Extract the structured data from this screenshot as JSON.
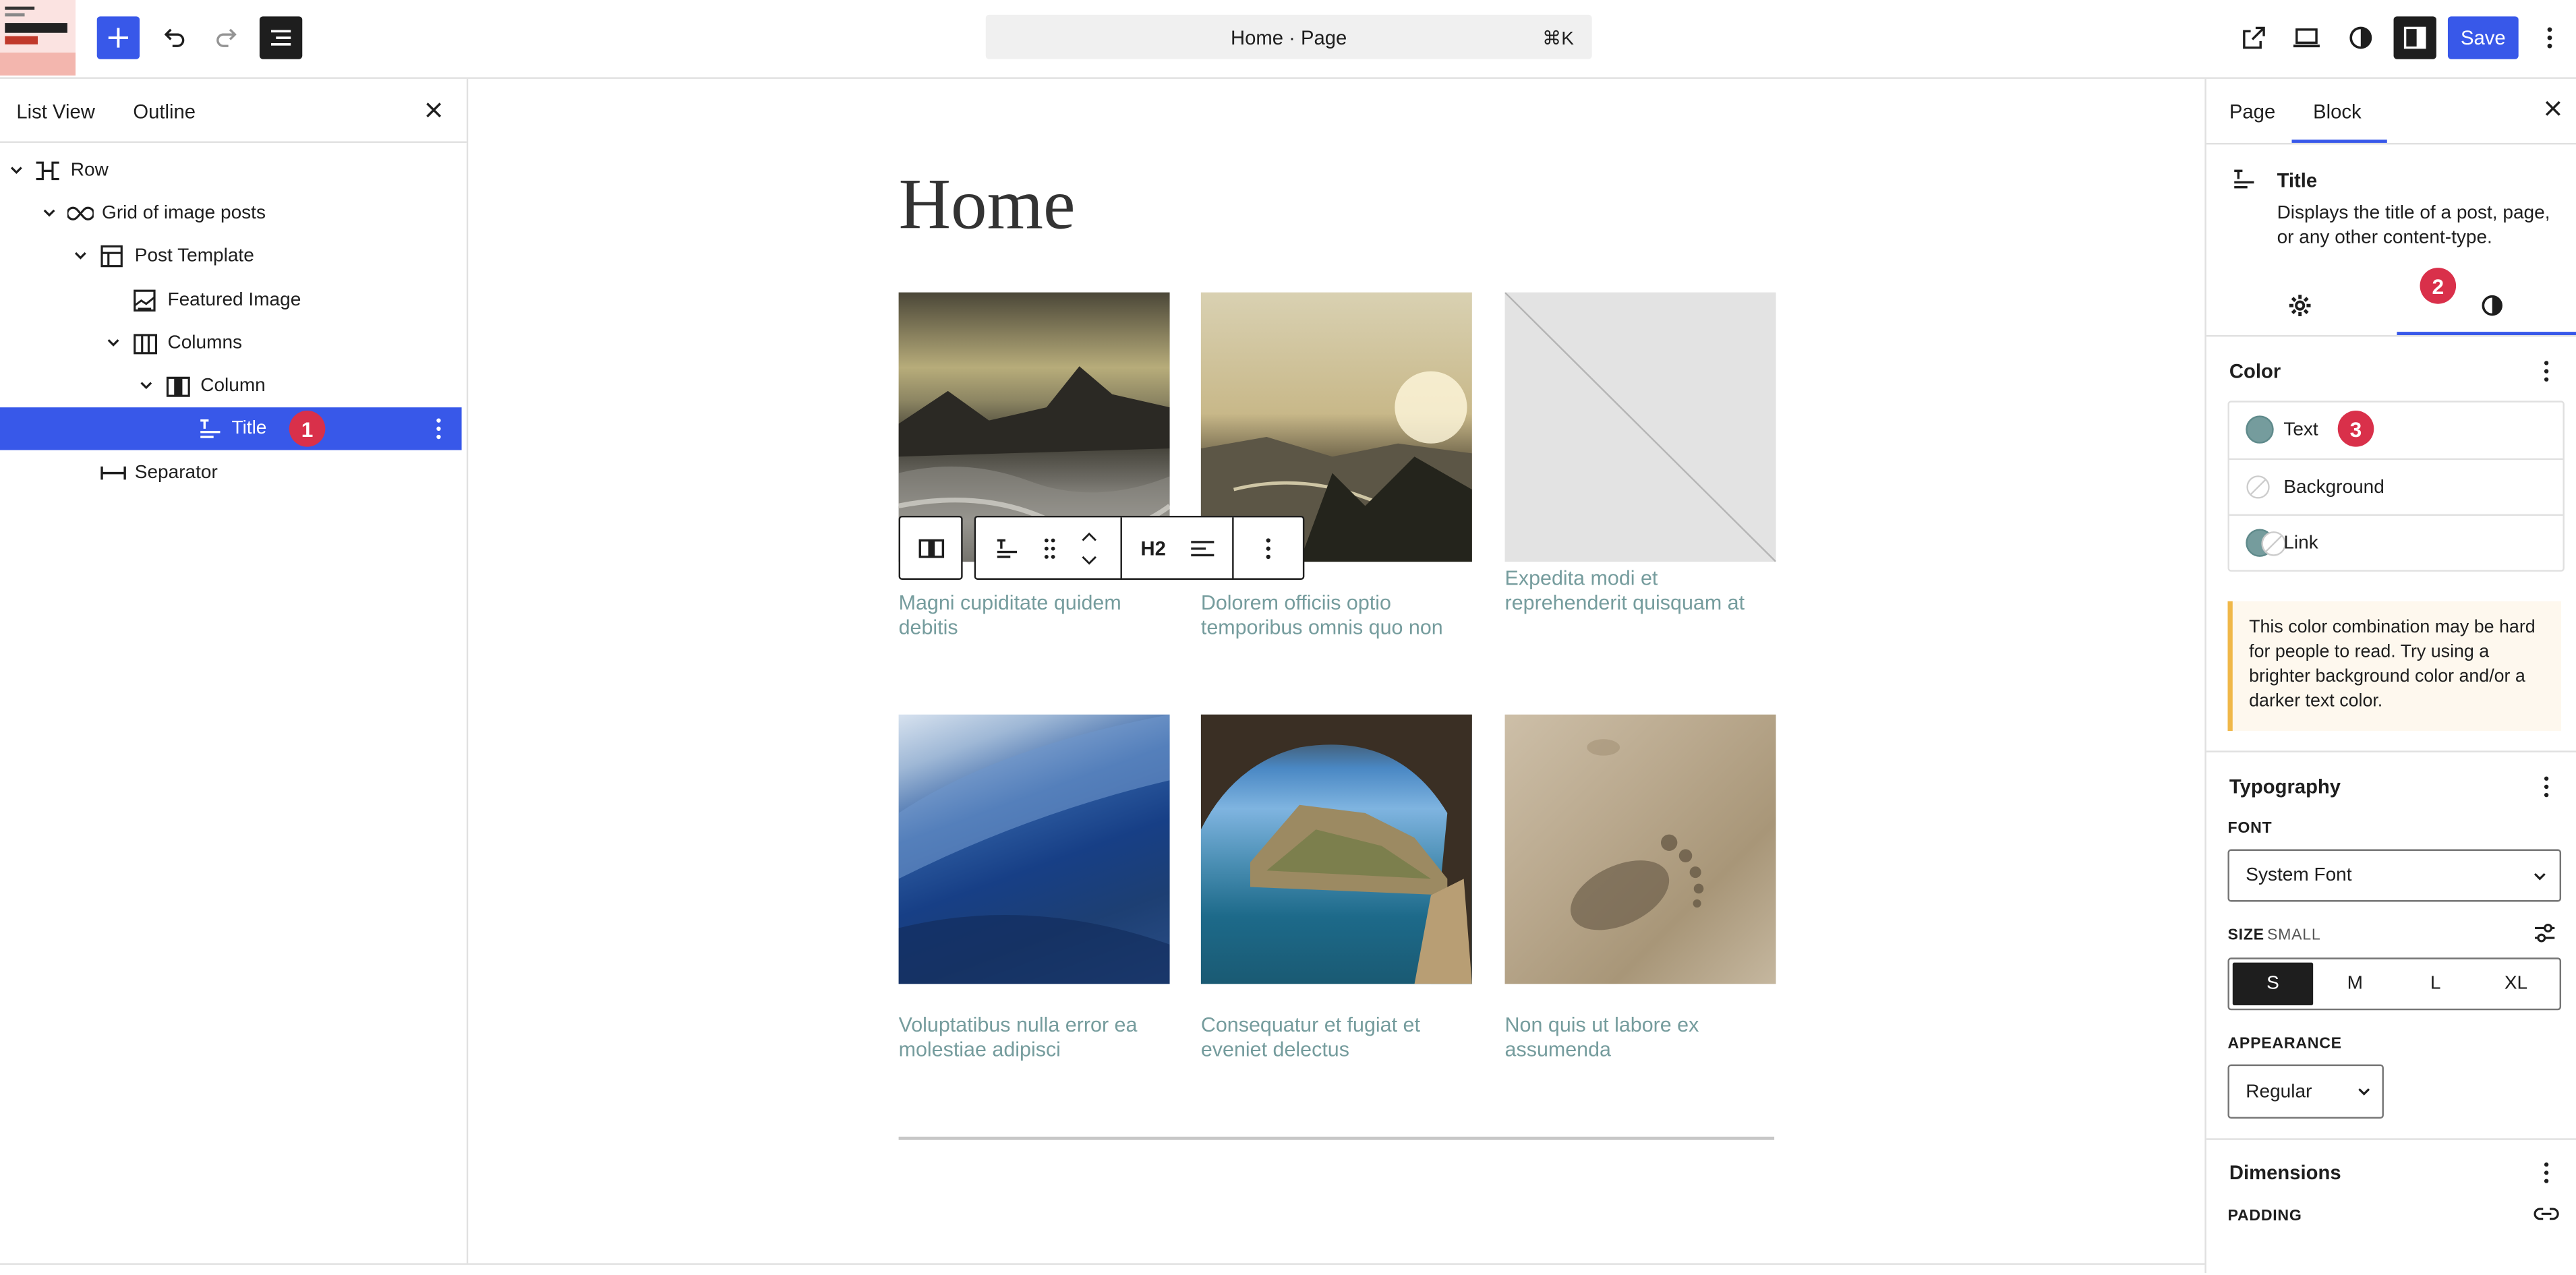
{
  "topbar": {
    "add_icon": "plus-icon",
    "undo_icon": "undo-icon",
    "redo_icon": "redo-icon",
    "document_overview_icon": "list-view-icon",
    "command_title": "Home · Page",
    "command_shortcut": "⌘K",
    "view_icon": "external-link-icon",
    "preview_icon": "laptop-icon",
    "styles_icon": "half-circle-icon",
    "settings_icon": "sidebar-icon",
    "save_label": "Save",
    "options_icon": "vertical-dots-icon"
  },
  "list_view": {
    "tabs": [
      "List View",
      "Outline"
    ],
    "active_tab": "List View",
    "items": [
      {
        "label": "Row",
        "icon": "row-icon",
        "expanded": true,
        "depth": 0
      },
      {
        "label": "Grid of image posts",
        "icon": "link-loop-icon",
        "expanded": true,
        "depth": 1
      },
      {
        "label": "Post Template",
        "icon": "layout-icon",
        "expanded": true,
        "depth": 2
      },
      {
        "label": "Featured Image",
        "icon": "image-icon",
        "depth": 3
      },
      {
        "label": "Columns",
        "icon": "columns-icon",
        "expanded": true,
        "depth": 3
      },
      {
        "label": "Column",
        "icon": "column-icon",
        "expanded": true,
        "depth": 4
      },
      {
        "label": "Title",
        "icon": "title-icon",
        "depth": 5,
        "selected": true,
        "badge": "1"
      },
      {
        "label": "Separator",
        "icon": "separator-icon",
        "depth": 2
      }
    ]
  },
  "canvas": {
    "page_title": "Home",
    "posts": [
      {
        "caption": "Magni cupiditate quidem debitis",
        "image": "rocky-shore-photo"
      },
      {
        "caption": "Dolorem officiis optio temporibus omnis quo non",
        "image": "mountain-sunset-photo"
      },
      {
        "caption": "Expedita modi et reprehenderit quisquam at",
        "image": "placeholder-image"
      },
      {
        "caption": "Voluptatibus nulla error ea molestiae adipisci",
        "image": "ocean-wave-photo"
      },
      {
        "caption": "Consequatur et fugiat et eveniet delectus",
        "image": "sea-cave-photo"
      },
      {
        "caption": "Non quis ut labore ex assumenda",
        "image": "footprint-sand-photo"
      }
    ],
    "block_toolbar": {
      "heading_level": "H2"
    }
  },
  "sidebar": {
    "tabs": [
      "Page",
      "Block"
    ],
    "active_tab": "Block",
    "block": {
      "name": "Title",
      "description": "Displays the title of a post, page, or any other content-type."
    },
    "sub_tabs": {
      "settings_icon": "gear-icon",
      "styles_icon": "half-circle-icon",
      "badge": "2"
    },
    "color": {
      "title": "Color",
      "items": [
        {
          "label": "Text",
          "swatch": "#759c9d",
          "badge": "3"
        },
        {
          "label": "Background",
          "swatch": "none"
        },
        {
          "label": "Link",
          "swatch": "#759c9d"
        }
      ],
      "notice": "This color combination may be hard for people to read. Try using a brighter background color and/or a darker text color."
    },
    "typography": {
      "title": "Typography",
      "font_label": "FONT",
      "font_value": "System Font",
      "size_label": "SIZE",
      "size_hint": "SMALL",
      "sizes": [
        "S",
        "M",
        "L",
        "XL"
      ],
      "size_selected": "S",
      "appearance_label": "APPEARANCE",
      "appearance_value": "Regular"
    },
    "dimensions": {
      "title": "Dimensions",
      "padding_label": "PADDING"
    }
  },
  "colors": {
    "accent": "#3858e9",
    "badge": "#d9304a",
    "caption": "#759c9d",
    "notice_border": "#f0b849"
  }
}
